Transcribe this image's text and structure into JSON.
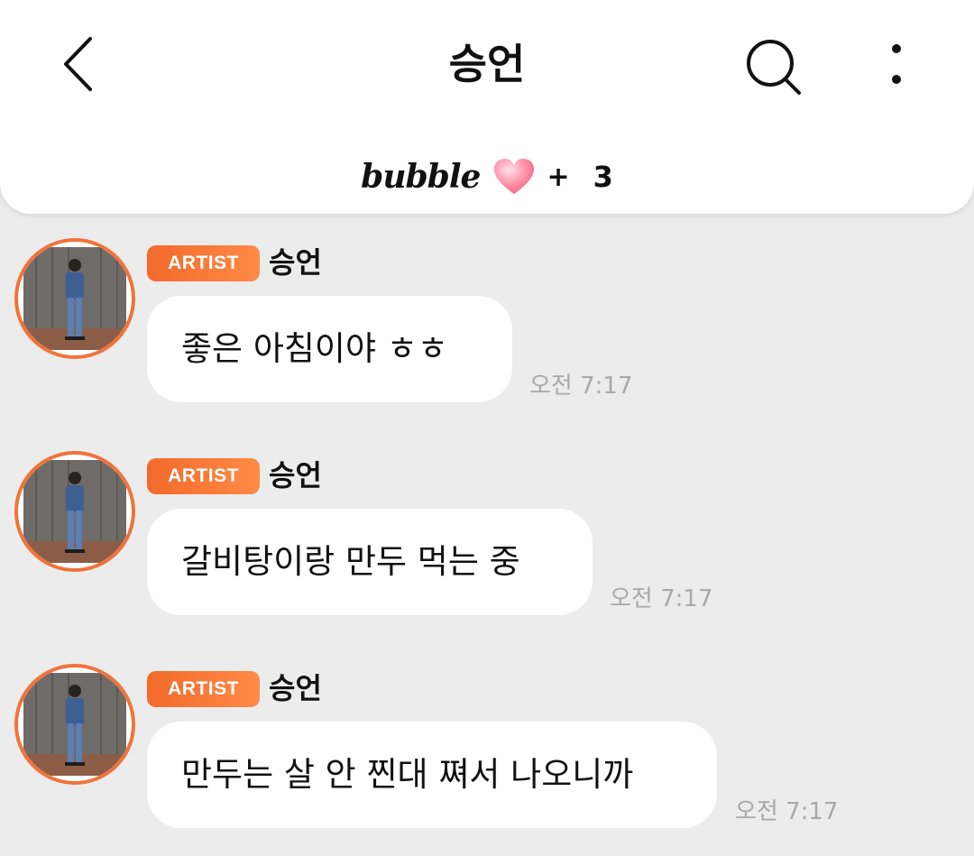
{
  "header": {
    "title": "승언",
    "subscription": {
      "logo_text": "bubble",
      "plus": "+",
      "count": "3"
    },
    "icons": [
      "chevron-left-icon",
      "search-icon",
      "more-vertical-icon",
      "heart-icon"
    ]
  },
  "messages": [
    {
      "badge": "ARTIST",
      "sender": "승언",
      "text": "좋은 아침이야 ㅎㅎ",
      "time": "오전 7:17"
    },
    {
      "badge": "ARTIST",
      "sender": "승언",
      "text": "갈비탕이랑 만두 먹는 중",
      "time": "오전 7:17"
    },
    {
      "badge": "ARTIST",
      "sender": "승언",
      "text": "만두는 살 안 찐대 쪄서 나오니까",
      "time": "오전 7:17"
    }
  ],
  "colors": {
    "background": "#ececec",
    "accent": "#f26a2b",
    "bubble": "#ffffff",
    "timestamp": "#a8a8a8"
  }
}
